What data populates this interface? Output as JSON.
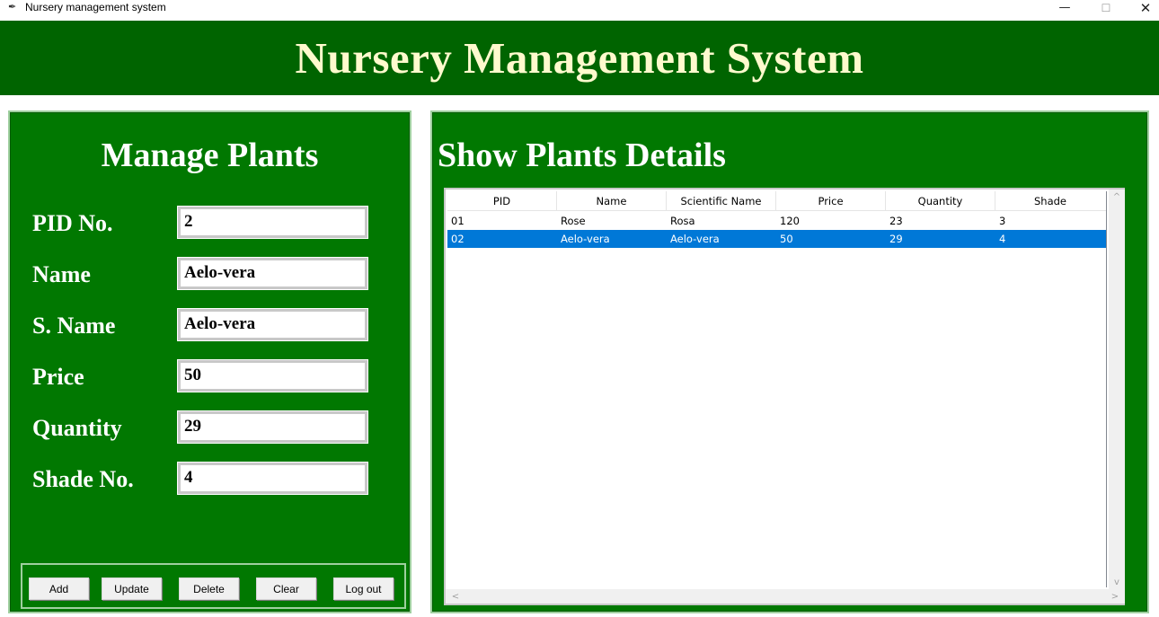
{
  "window": {
    "title": "Nursery management system",
    "app_icon": "feather-icon",
    "minimize_glyph": "—",
    "maximize_glyph": "☐",
    "close_glyph": "✕"
  },
  "header": {
    "title": "Nursery Management System",
    "bg_color": "#006400",
    "text_color": "#fffacd"
  },
  "left_panel": {
    "title": "Manage Plants",
    "fields": [
      {
        "label": "PID No.",
        "value": "2"
      },
      {
        "label": "Name",
        "value": "Aelo-vera"
      },
      {
        "label": "S. Name",
        "value": "Aelo-vera"
      },
      {
        "label": "Price",
        "value": "50"
      },
      {
        "label": "Quantity",
        "value": "29"
      },
      {
        "label": "Shade No.",
        "value": "4"
      }
    ],
    "buttons": [
      "Add",
      "Update",
      "Delete",
      "Clear",
      "Log out"
    ]
  },
  "right_panel": {
    "title": "Show Plants Details",
    "columns": [
      "PID",
      "Name",
      "Scientific Name",
      "Price",
      "Quantity",
      "Shade"
    ],
    "rows": [
      {
        "cells": [
          "01",
          "Rose",
          "Rosa",
          "120",
          "23",
          "3"
        ],
        "selected": false
      },
      {
        "cells": [
          "02",
          "Aelo-vera",
          "Aelo-vera",
          "50",
          "29",
          "4"
        ],
        "selected": true
      }
    ],
    "scroll_glyphs": {
      "up": "^",
      "down": "v",
      "left": "<",
      "right": ">"
    },
    "selection_color": "#0078d7"
  },
  "colors": {
    "panel_green": "#017801"
  }
}
